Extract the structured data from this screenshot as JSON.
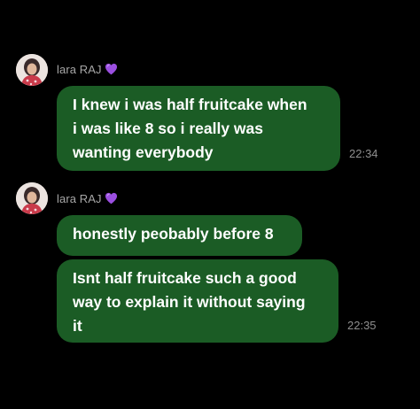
{
  "messages": [
    {
      "sender": "lara RAJ",
      "sender_icon": "purple-heart-icon",
      "bubbles": [
        {
          "text": "I knew i was half fruitcake when\ni was like 8 so i really was\nwanting everybody",
          "time": "22:34"
        }
      ]
    },
    {
      "sender": "lara RAJ",
      "sender_icon": "purple-heart-icon",
      "bubbles": [
        {
          "text": "honestly peobably before 8",
          "time": ""
        },
        {
          "text": "Isnt half fruitcake such a good\nway to explain it without saying\nit",
          "time": "22:35"
        }
      ]
    }
  ],
  "colors": {
    "background": "#000000",
    "bubble": "#1b5c25",
    "bubble_text": "#ffffff",
    "sender_text": "#a7a7a7",
    "timestamp": "#8f8f8f",
    "heart": "#9b4fe0"
  }
}
